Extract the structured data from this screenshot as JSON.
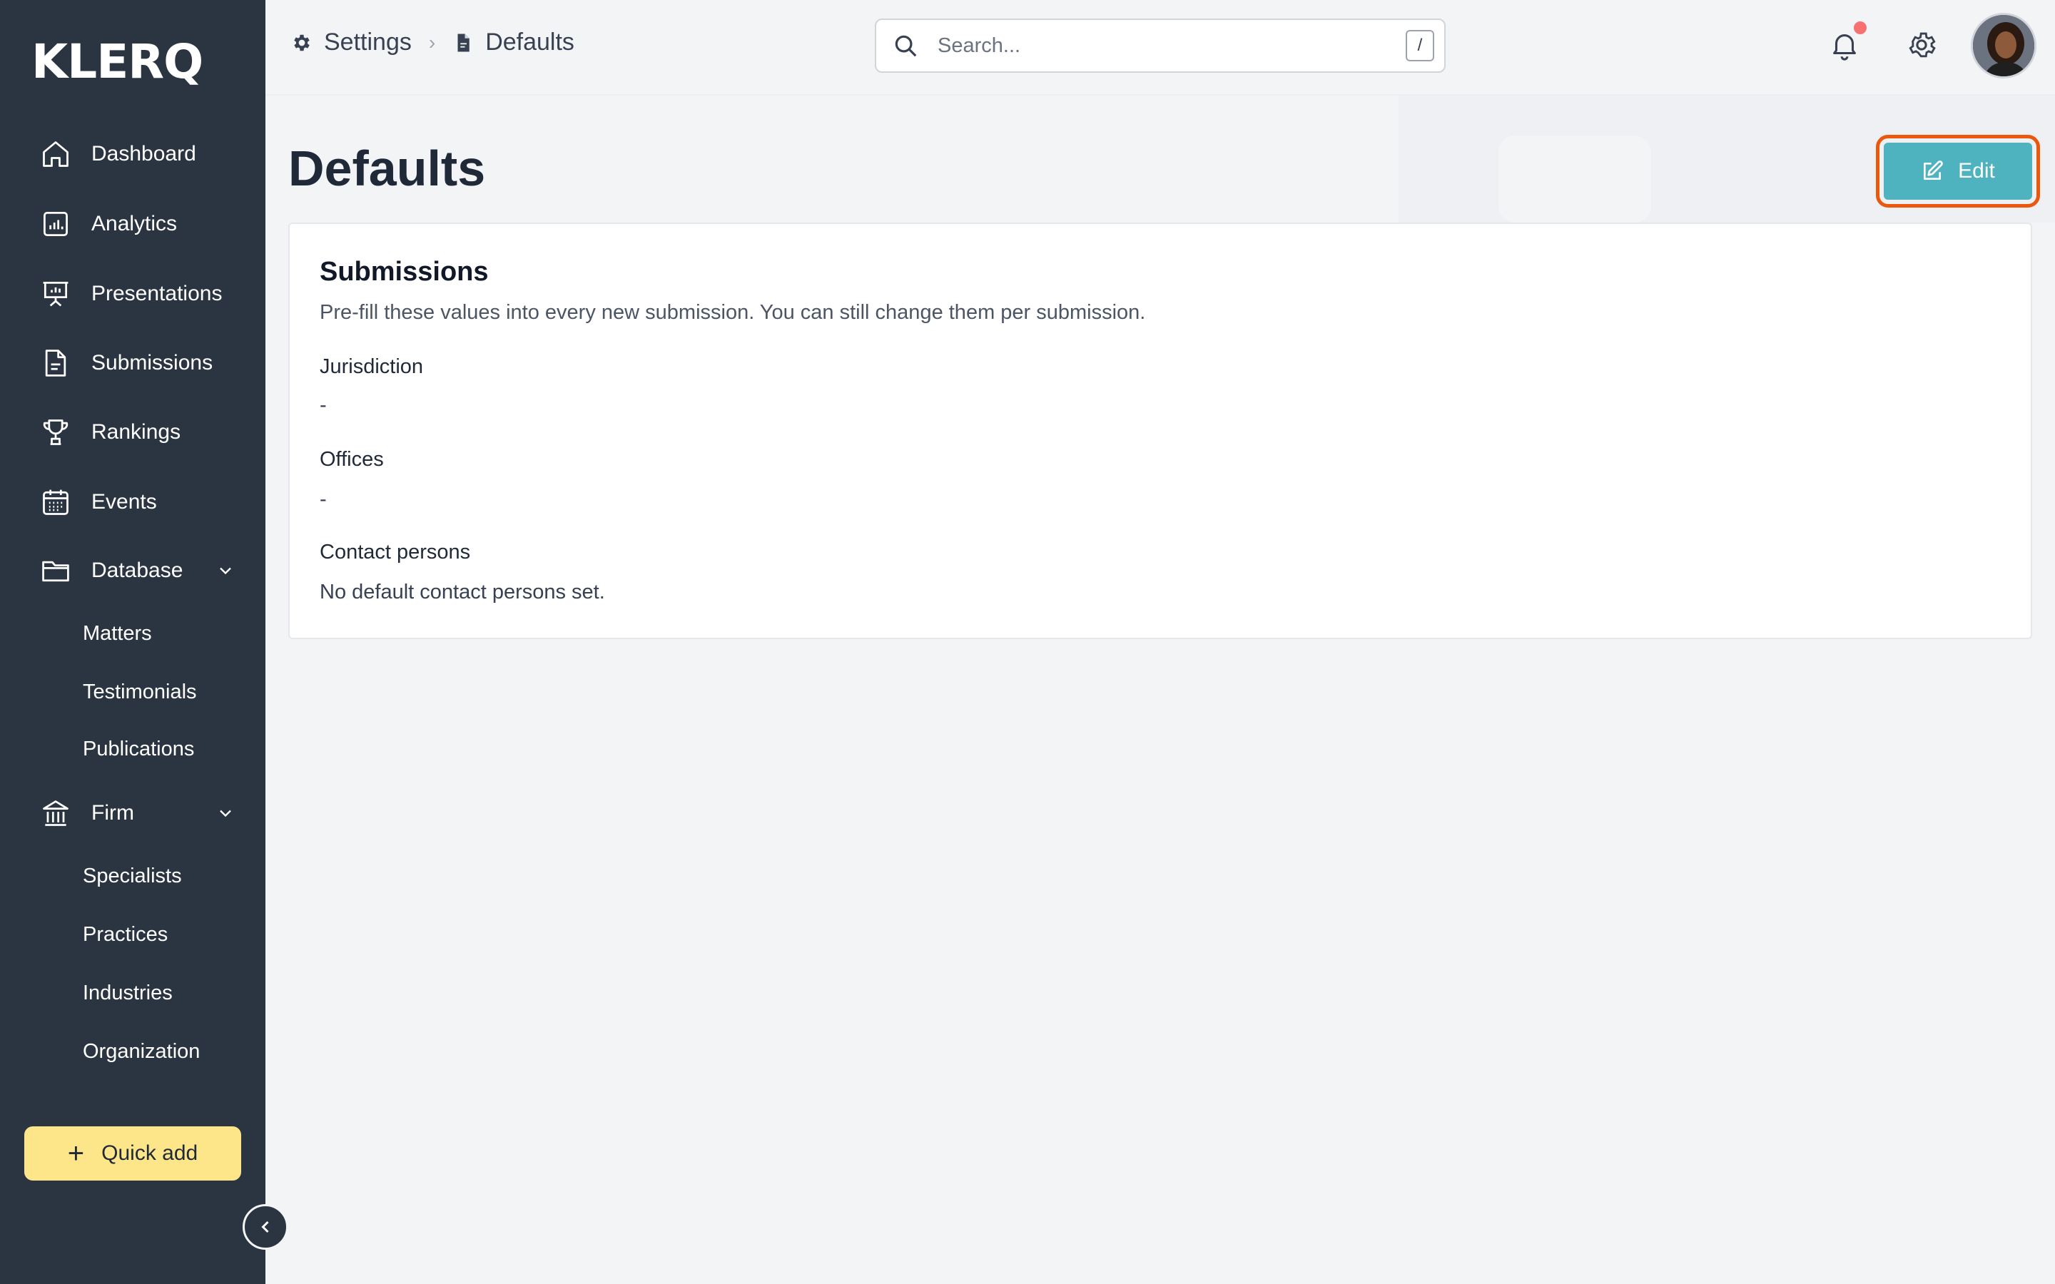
{
  "app": {
    "logo": "KLERQ"
  },
  "sidebar": {
    "items": [
      {
        "label": "Dashboard",
        "icon": "home-icon"
      },
      {
        "label": "Analytics",
        "icon": "analytics-icon"
      },
      {
        "label": "Presentations",
        "icon": "presentation-icon"
      },
      {
        "label": "Submissions",
        "icon": "document-icon"
      },
      {
        "label": "Rankings",
        "icon": "trophy-icon"
      },
      {
        "label": "Events",
        "icon": "calendar-icon"
      },
      {
        "label": "Database",
        "icon": "folder-icon",
        "expanded": true,
        "children": [
          "Matters",
          "Testimonials",
          "Publications"
        ]
      },
      {
        "label": "Firm",
        "icon": "bank-icon",
        "expanded": true,
        "children": [
          "Specialists",
          "Practices",
          "Industries",
          "Organization"
        ]
      }
    ],
    "quick_add": "Quick add"
  },
  "header": {
    "breadcrumb": [
      {
        "label": "Settings",
        "icon": "gear-icon"
      },
      {
        "label": "Defaults",
        "icon": "file-icon"
      }
    ],
    "search": {
      "placeholder": "Search...",
      "shortcut": "/"
    },
    "notifications": {
      "has_unread": true
    }
  },
  "main": {
    "title": "Defaults",
    "edit_label": "Edit",
    "card": {
      "title": "Submissions",
      "description": "Pre-fill these values into every new submission. You can still change them per submission.",
      "fields": [
        {
          "label": "Jurisdiction",
          "value": "-"
        },
        {
          "label": "Offices",
          "value": "-"
        },
        {
          "label": "Contact persons",
          "value": "No default contact persons set."
        }
      ]
    }
  },
  "colors": {
    "sidebar_bg": "#2b3542",
    "accent": "#4fb3bf",
    "quick_add_bg": "#fde68a",
    "highlight_outline": "#ea580c",
    "notification_dot": "#f87171"
  }
}
